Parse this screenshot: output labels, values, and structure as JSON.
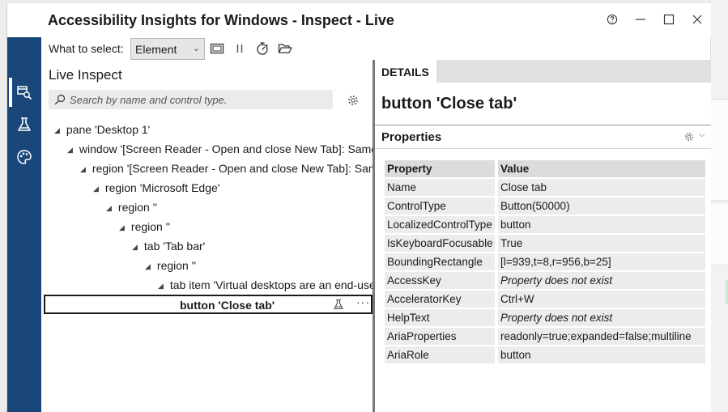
{
  "window": {
    "title": "Accessibility Insights for Windows - Inspect - Live",
    "controls": [
      "help-icon",
      "minimize-icon",
      "maximize-icon",
      "close-icon"
    ]
  },
  "nav": {
    "items": [
      "live-inspect-icon",
      "tests-flask-icon",
      "color-contrast-palette-icon"
    ],
    "selected": "live-inspect-icon",
    "color": "#19477a"
  },
  "toolbar": {
    "what_to_select_label": "What to select:",
    "select_value": "Element",
    "icons": [
      "screenshot-window-icon",
      "pause-icon",
      "timer-icon",
      "open-folder-icon"
    ]
  },
  "live_inspect": {
    "title": "Live Inspect",
    "search_placeholder": "Search by name and control type.",
    "tree": [
      {
        "label": "pane 'Desktop 1'",
        "depth": 0
      },
      {
        "label": "window '[Screen Reader - Open and close New Tab]: Same r",
        "depth": 1
      },
      {
        "label": "region '[Screen Reader - Open and close New Tab]: Same",
        "depth": 2
      },
      {
        "label": "region 'Microsoft Edge'",
        "depth": 3
      },
      {
        "label": "region ''",
        "depth": 4
      },
      {
        "label": "region ''",
        "depth": 5
      },
      {
        "label": "tab 'Tab bar'",
        "depth": 6
      },
      {
        "label": "region ''",
        "depth": 7
      },
      {
        "label": "tab item 'Virtual desktops are an end-use",
        "depth": 8
      }
    ],
    "selected_item": "button 'Close tab'",
    "more_label": "···"
  },
  "details": {
    "tab_label": "DETAILS",
    "element_title": "button 'Close tab'",
    "properties_title": "Properties",
    "columns": [
      "Property",
      "Value"
    ],
    "rows": [
      {
        "property": "Name",
        "value": "Close tab",
        "italic": false
      },
      {
        "property": "ControlType",
        "value": "Button(50000)",
        "italic": false
      },
      {
        "property": "LocalizedControlType",
        "value": "button",
        "italic": false
      },
      {
        "property": "IsKeyboardFocusable",
        "value": "True",
        "italic": false
      },
      {
        "property": "BoundingRectangle",
        "value": "[l=939,t=8,r=956,b=25]",
        "italic": false
      },
      {
        "property": "AccessKey",
        "value": "Property does not exist",
        "italic": true
      },
      {
        "property": "AcceleratorKey",
        "value": "Ctrl+W",
        "italic": false
      },
      {
        "property": "HelpText",
        "value": "Property does not exist",
        "italic": true
      },
      {
        "property": "AriaProperties",
        "value": "readonly=true;expanded=false;multiline",
        "italic": false
      },
      {
        "property": "AriaRole",
        "value": "button",
        "italic": false
      }
    ]
  }
}
